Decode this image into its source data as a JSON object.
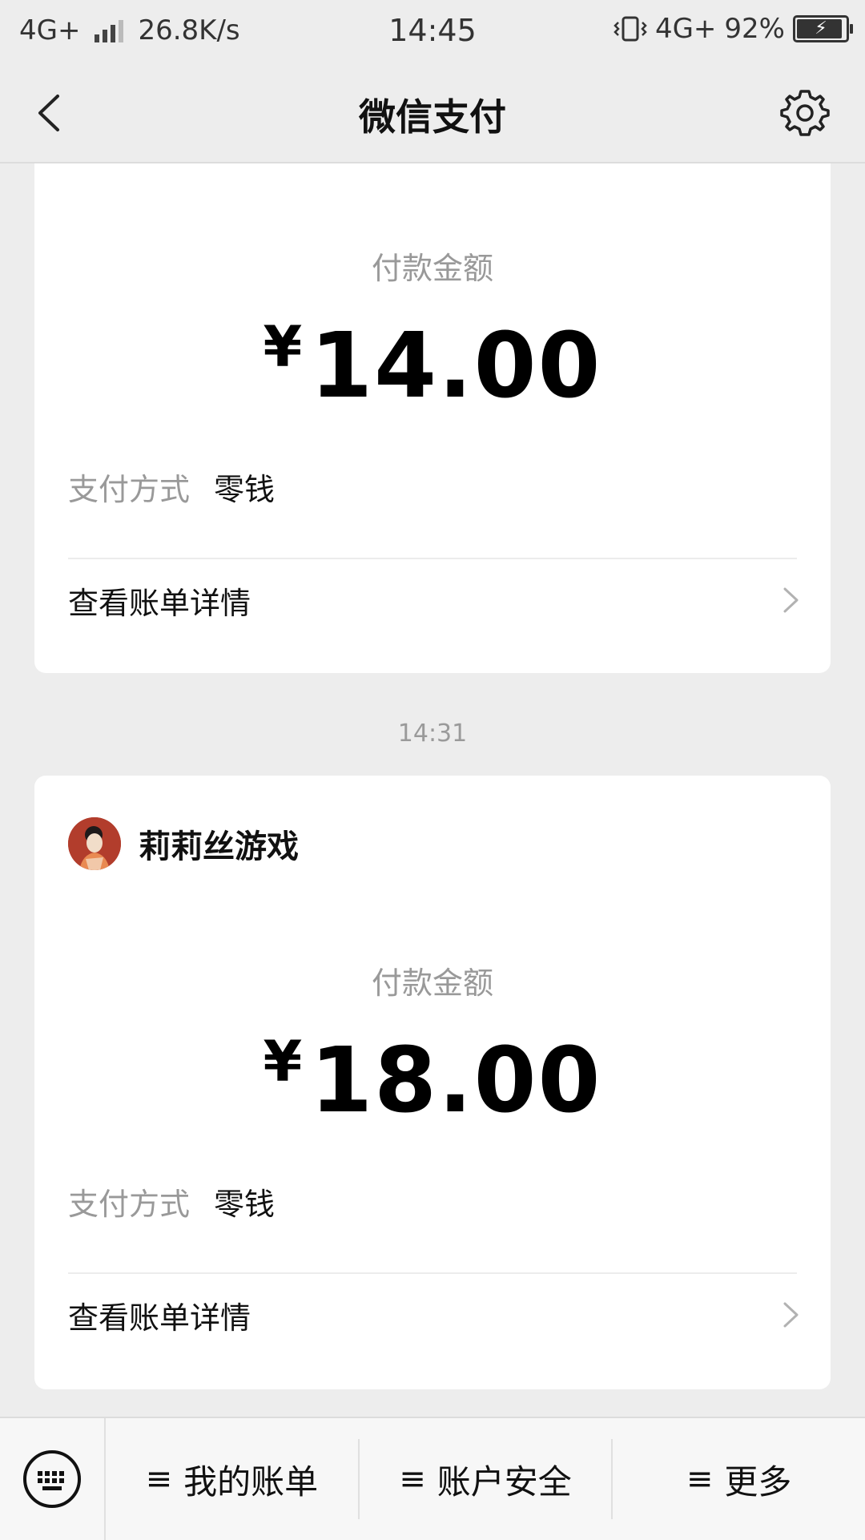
{
  "status_bar": {
    "network_left": "4G+",
    "speed": "26.8K/s",
    "time": "14:45",
    "network_right": "4G+",
    "battery": "92%"
  },
  "nav": {
    "title": "微信支付",
    "back_icon": "chevron-left-icon",
    "settings_icon": "gear-icon"
  },
  "transactions": [
    {
      "amount_label": "付款金额",
      "currency": "¥",
      "amount": "14.00",
      "pay_method_label": "支付方式",
      "pay_method_value": "零钱",
      "detail_link": "查看账单详情"
    },
    {
      "time": "14:31",
      "merchant": "莉莉丝游戏",
      "amount_label": "付款金额",
      "currency": "¥",
      "amount": "18.00",
      "pay_method_label": "支付方式",
      "pay_method_value": "零钱",
      "detail_link": "查看账单详情"
    }
  ],
  "bottom_bar": {
    "keyboard_icon": "keyboard-icon",
    "menu": [
      {
        "label": "我的账单"
      },
      {
        "label": "账户安全"
      },
      {
        "label": "更多"
      }
    ]
  }
}
